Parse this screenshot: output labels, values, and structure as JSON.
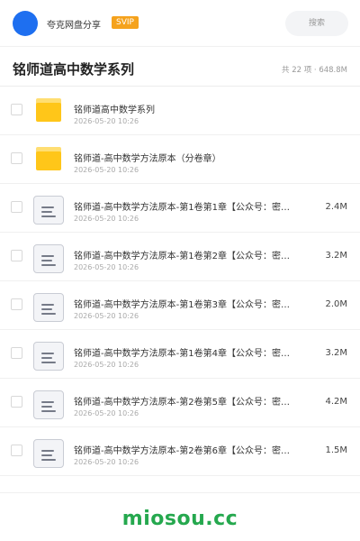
{
  "header": {
    "site_name": "夸克网盘分享",
    "badge": "SVIP",
    "search_label": "搜索",
    "avatar_color": "#1e6ff0"
  },
  "folder": {
    "title": "铭师道高中数学系列",
    "meta": "共 22 项 · 648.8M"
  },
  "files": [
    {
      "type": "folder",
      "name": "铭师道高中数学系列",
      "date": "2026-05-20 10:26",
      "size": ""
    },
    {
      "type": "folder",
      "name": "铭师道-高中数学方法原本（分卷章）",
      "date": "2026-05-20 10:26",
      "size": ""
    },
    {
      "type": "file",
      "name": "铭师道-高中数学方法原本-第1卷第1章【公众号：密…",
      "date": "2026-05-20 10:26",
      "size": "2.4M"
    },
    {
      "type": "file",
      "name": "铭师道-高中数学方法原本-第1卷第2章【公众号：密…",
      "date": "2026-05-20 10:26",
      "size": "3.2M"
    },
    {
      "type": "file",
      "name": "铭师道-高中数学方法原本-第1卷第3章【公众号：密…",
      "date": "2026-05-20 10:26",
      "size": "2.0M"
    },
    {
      "type": "file",
      "name": "铭师道-高中数学方法原本-第1卷第4章【公众号：密…",
      "date": "2026-05-20 10:26",
      "size": "3.2M"
    },
    {
      "type": "file",
      "name": "铭师道-高中数学方法原本-第2卷第5章【公众号：密…",
      "date": "2026-05-20 10:26",
      "size": "4.2M"
    },
    {
      "type": "file",
      "name": "铭师道-高中数学方法原本-第2卷第6章【公众号：密…",
      "date": "2026-05-20 10:26",
      "size": "1.5M"
    }
  ],
  "watermark": "miosou.cc",
  "colors": {
    "badge": "#f5a21c",
    "folder": "#ffc619",
    "watermark": "#25a84e"
  }
}
